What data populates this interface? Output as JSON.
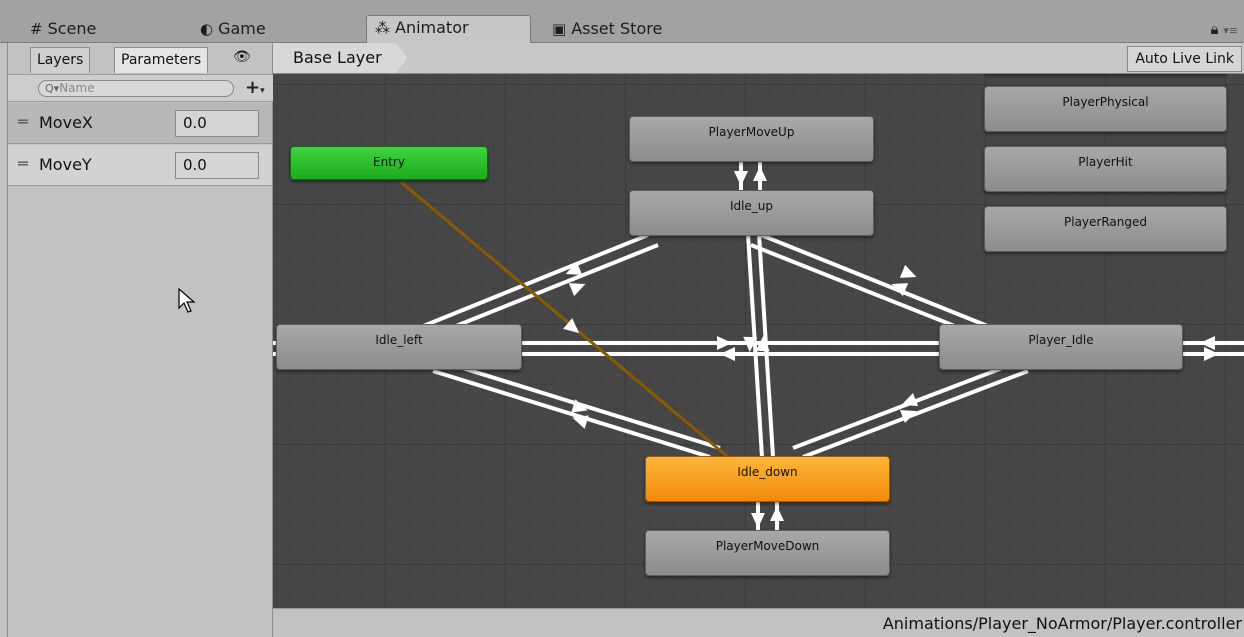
{
  "tabs": [
    {
      "icon": "#",
      "label": "Scene"
    },
    {
      "icon": "◐",
      "label": "Game"
    },
    {
      "icon": "⁂",
      "label": "Animator"
    },
    {
      "icon": "▣",
      "label": "Asset Store"
    }
  ],
  "left_panel": {
    "tabs": {
      "layers": "Layers",
      "parameters": "Parameters"
    },
    "search_placeholder": "Name",
    "parameters": [
      {
        "name": "MoveX",
        "value": "0.0"
      },
      {
        "name": "MoveY",
        "value": "0.0"
      }
    ]
  },
  "graph": {
    "breadcrumb": "Base Layer",
    "auto_live_link": "Auto Live Link",
    "states": {
      "entry": "Entry",
      "player_move_up": "PlayerMoveUp",
      "idle_up": "Idle_up",
      "idle_left": "Idle_left",
      "player_idle": "Player_Idle",
      "idle_down": "Idle_down",
      "player_move_down": "PlayerMoveDown",
      "player_physical": "PlayerPhysical",
      "player_hit": "PlayerHit",
      "player_ranged": "PlayerRanged"
    },
    "colors": {
      "default_state": "#9a9a9a",
      "entry_state": "#2ec22e",
      "default_transition": "#8a5a00",
      "active_state": "#f5960f"
    }
  },
  "status_path": "Animations/Player_NoArmor/Player.controller"
}
